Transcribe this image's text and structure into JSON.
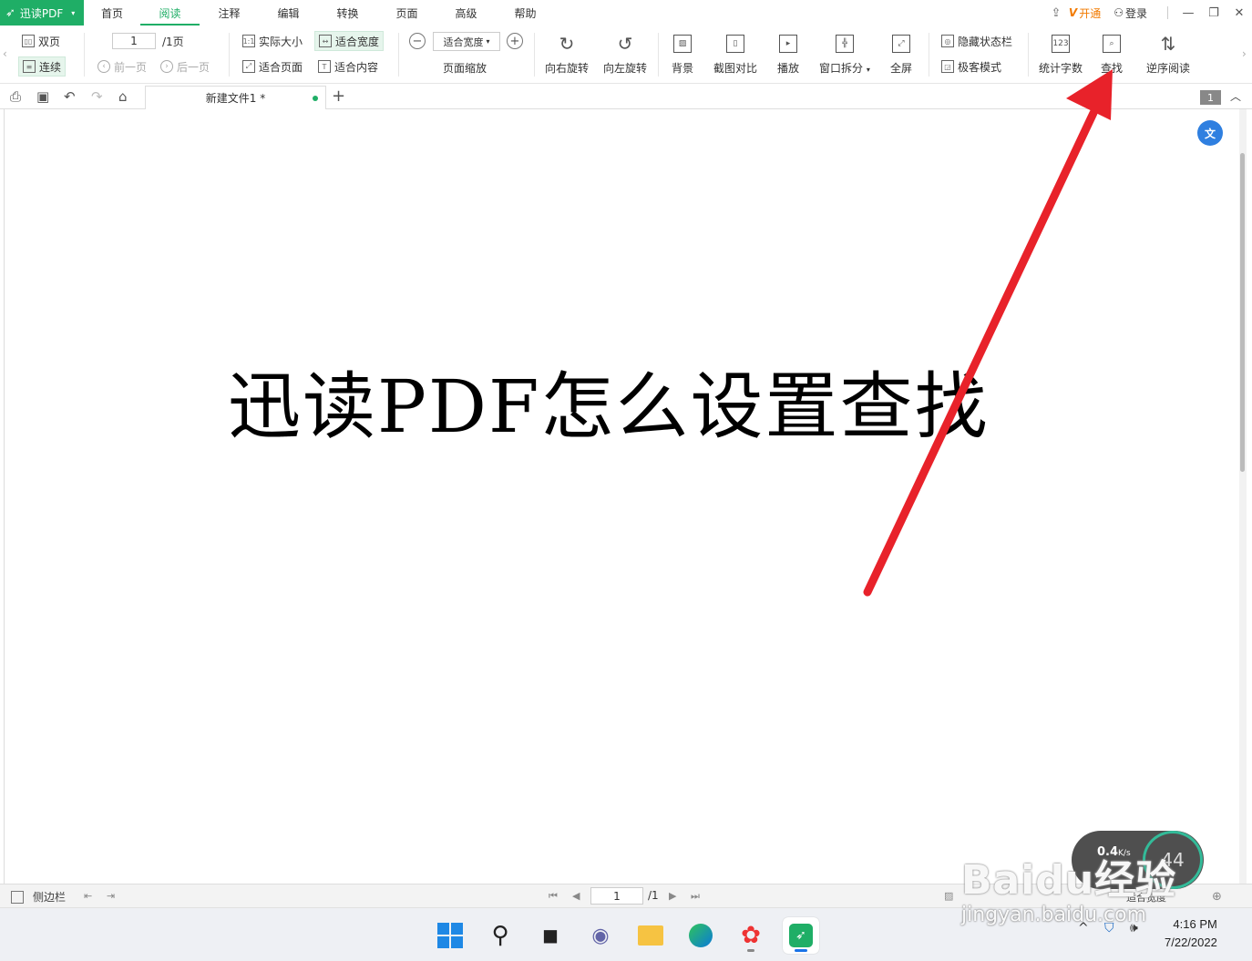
{
  "app": {
    "logo_label": "迅读PDF",
    "menu": [
      "首页",
      "阅读",
      "注释",
      "编辑",
      "转换",
      "页面",
      "高级",
      "帮助"
    ],
    "active_menu_index": 1,
    "vip_label": "开通",
    "login_label": "登录"
  },
  "ribbon": {
    "double_page": "双页",
    "continuous": "连续",
    "page_input": "1",
    "page_total": "/1页",
    "prev_page": "前一页",
    "next_page": "后一页",
    "actual_size": "实际大小",
    "fit_width": "适合宽度",
    "fit_page": "适合页面",
    "fit_content": "适合内容",
    "zoom_value": "适合宽度",
    "zoom_label": "页面缩放",
    "rotate_right": "向右旋转",
    "rotate_left": "向左旋转",
    "background": "背景",
    "screenshot_compare": "截图对比",
    "play": "播放",
    "window_split": "窗口拆分",
    "fullscreen": "全屏",
    "hide_statusbar": "隐藏状态栏",
    "minimal_mode": "极客模式",
    "word_count": "统计字数",
    "find": "查找",
    "reverse_read": "逆序阅读"
  },
  "tabs": {
    "doc_tab": "新建文件1 *",
    "page_badge": "1"
  },
  "document": {
    "text": "迅读PDF怎么设置查找"
  },
  "statusbar": {
    "sidebar_label": "侧边栏",
    "page_input": "1",
    "page_total": "/1",
    "zoom_value": "适合宽度"
  },
  "taskbar": {
    "time": "4:16 PM",
    "date": "7/22/2022"
  },
  "overlay": {
    "speed": "0.4",
    "speed_unit": "K/s",
    "percent": "44",
    "watermark": "Baidu经验",
    "watermark_url": "jingyan.baidu.com",
    "arrow_color": "#e8222a"
  },
  "colors": {
    "accent": "#1fae66",
    "vip": "#f27a00"
  }
}
